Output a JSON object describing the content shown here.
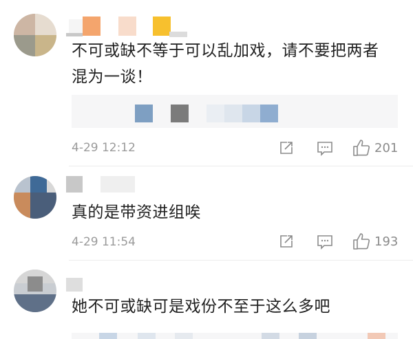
{
  "comments": [
    {
      "text_line1": "不可或缺不等于可以乱加戏，请不要把两者",
      "text_line2": "混为一谈！",
      "time": "4-29 12:12",
      "likes": "201"
    },
    {
      "text_line1": "真的是带资进组唉",
      "time": "4-29 11:54",
      "likes": "193"
    },
    {
      "text_line1": "她不可或缺可是戏份不至于这么多吧"
    }
  ]
}
